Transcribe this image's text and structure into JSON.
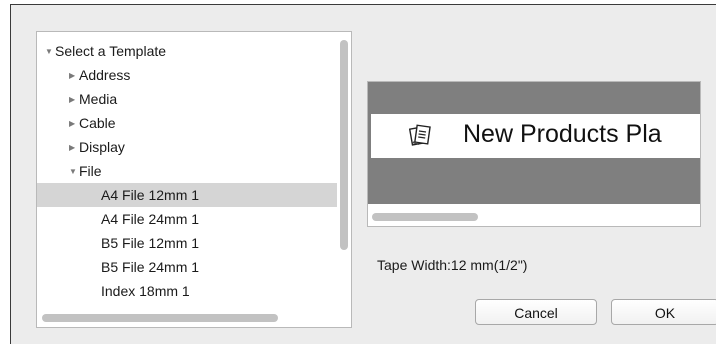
{
  "tree": {
    "items": [
      {
        "label": "Select a Template",
        "toggle": "▼",
        "level": 0
      },
      {
        "label": "Address",
        "toggle": "▶",
        "level": 1
      },
      {
        "label": "Media",
        "toggle": "▶",
        "level": 1
      },
      {
        "label": "Cable",
        "toggle": "▶",
        "level": 1
      },
      {
        "label": "Display",
        "toggle": "▶",
        "level": 1
      },
      {
        "label": "File",
        "toggle": "▼",
        "level": 1
      },
      {
        "label": "A4 File 12mm 1",
        "level": 2,
        "selected": true
      },
      {
        "label": "A4 File 24mm 1",
        "level": 2
      },
      {
        "label": "B5 File 12mm 1",
        "level": 2
      },
      {
        "label": "B5 File 24mm 1",
        "level": 2
      },
      {
        "label": "Index 18mm 1",
        "level": 2
      }
    ]
  },
  "preview": {
    "label_text": "New Products Pla",
    "icon": "document-stack-icon"
  },
  "tape_width": "Tape Width:12 mm(1/2\")",
  "buttons": {
    "cancel": "Cancel",
    "ok": "OK"
  },
  "colors": {
    "selection": "#d5d5d5",
    "preview_background": "#7f7f7f"
  }
}
